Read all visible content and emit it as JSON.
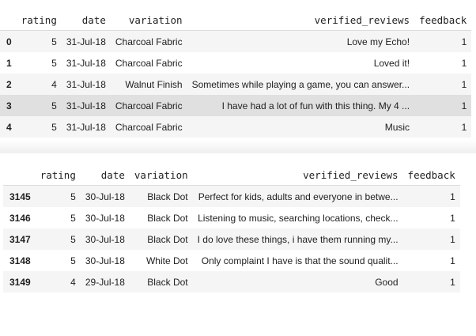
{
  "table1": {
    "columns": [
      "",
      "rating",
      "date",
      "variation",
      "verified_reviews",
      "feedback"
    ],
    "rows": [
      {
        "index": "0",
        "rating": "5",
        "date": "31-Jul-18",
        "variation": "Charcoal Fabric",
        "verified_reviews": "Love my Echo!",
        "feedback": "1"
      },
      {
        "index": "1",
        "rating": "5",
        "date": "31-Jul-18",
        "variation": "Charcoal Fabric",
        "verified_reviews": "Loved it!",
        "feedback": "1"
      },
      {
        "index": "2",
        "rating": "4",
        "date": "31-Jul-18",
        "variation": "Walnut Finish",
        "verified_reviews": "Sometimes while playing a game, you can answer...",
        "feedback": "1"
      },
      {
        "index": "3",
        "rating": "5",
        "date": "31-Jul-18",
        "variation": "Charcoal Fabric",
        "verified_reviews": "I have had a lot of fun with this thing. My 4 ...",
        "feedback": "1"
      },
      {
        "index": "4",
        "rating": "5",
        "date": "31-Jul-18",
        "variation": "Charcoal Fabric",
        "verified_reviews": "Music",
        "feedback": "1"
      }
    ]
  },
  "table2": {
    "columns": [
      "",
      "rating",
      "date",
      "variation",
      "verified_reviews",
      "feedback"
    ],
    "rows": [
      {
        "index": "3145",
        "rating": "5",
        "date": "30-Jul-18",
        "variation": "Black Dot",
        "verified_reviews": "Perfect for kids, adults and everyone in betwe...",
        "feedback": "1"
      },
      {
        "index": "3146",
        "rating": "5",
        "date": "30-Jul-18",
        "variation": "Black Dot",
        "verified_reviews": "Listening to music, searching locations, check...",
        "feedback": "1"
      },
      {
        "index": "3147",
        "rating": "5",
        "date": "30-Jul-18",
        "variation": "Black Dot",
        "verified_reviews": "I do love these things, i have them running my...",
        "feedback": "1"
      },
      {
        "index": "3148",
        "rating": "5",
        "date": "30-Jul-18",
        "variation": "White Dot",
        "verified_reviews": "Only complaint I have is that the sound qualit...",
        "feedback": "1"
      },
      {
        "index": "3149",
        "rating": "4",
        "date": "29-Jul-18",
        "variation": "Black Dot",
        "verified_reviews": "Good",
        "feedback": "1"
      }
    ]
  }
}
